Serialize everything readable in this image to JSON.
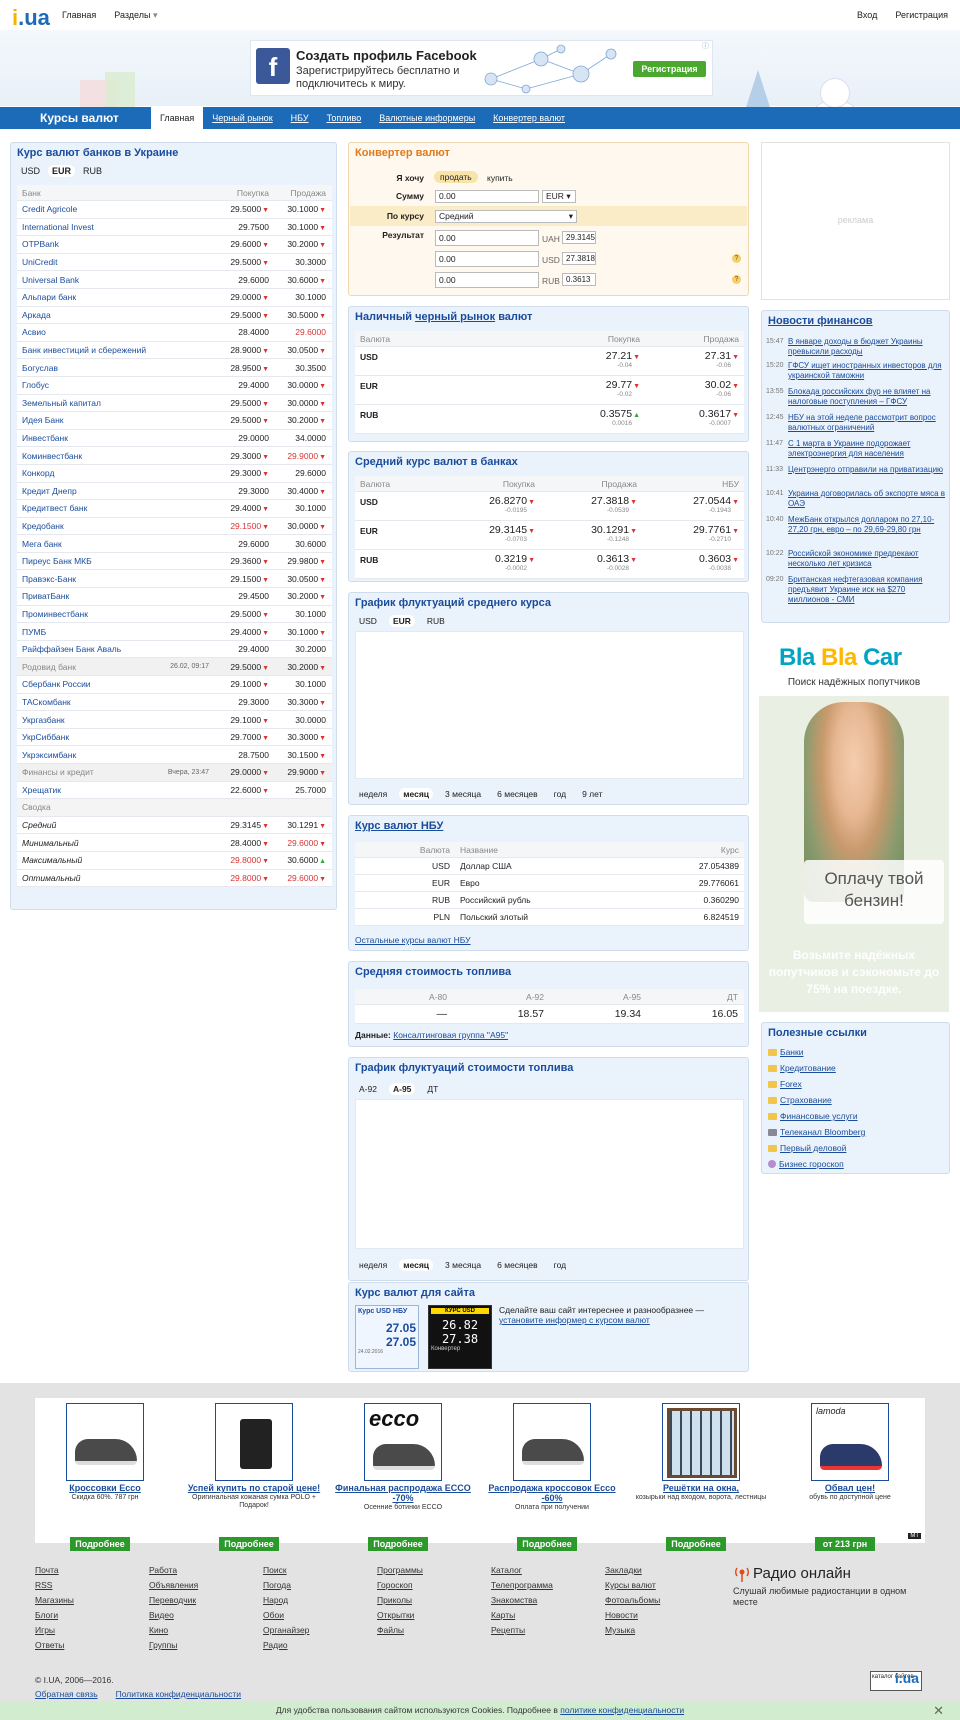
{
  "topbar": {
    "home": "Главная",
    "sections": "Разделы",
    "login": "Вход",
    "register": "Регистрация"
  },
  "fb_ad": {
    "title": "Создать профиль Facebook",
    "subtitle": "Зарегистрируйтесь бесплатно и подключитесь к миру.",
    "button": "Регистрация"
  },
  "nav": {
    "title": "Курсы валют",
    "tabs": [
      "Главная",
      "Черный рынок",
      "НБУ",
      "Топливо",
      "Валютные информеры",
      "Конвертер валют"
    ]
  },
  "banks": {
    "title": "Курс валют банков в Украине",
    "currencies": [
      "USD",
      "EUR",
      "RUB"
    ],
    "headers": [
      "Банк",
      "Покупка",
      "Продажа"
    ],
    "rows": [
      {
        "name": "Credit Agricole",
        "buy": "29.5000",
        "sell": "30.1000"
      },
      {
        "name": "International Invest",
        "buy": "29.7500",
        "sell": "30.1000"
      },
      {
        "name": "OTPBank",
        "buy": "29.6000",
        "sell": "30.2000"
      },
      {
        "name": "UniCredit",
        "buy": "29.5000",
        "sell": "30.3000"
      },
      {
        "name": "Universal Bank",
        "buy": "29.6000",
        "sell": "30.6000"
      },
      {
        "name": "Альпари банк",
        "buy": "29.0000",
        "sell": "30.1000"
      },
      {
        "name": "Аркада",
        "buy": "29.5000",
        "sell": "30.5000"
      },
      {
        "name": "Асвио",
        "buy": "28.4000",
        "sell": "29.6000"
      },
      {
        "name": "Банк инвестиций и сбережений",
        "buy": "28.9000",
        "sell": "30.0500"
      },
      {
        "name": "Богуслав",
        "buy": "28.9500",
        "sell": "30.3500"
      },
      {
        "name": "Глобус",
        "buy": "29.4000",
        "sell": "30.0000"
      },
      {
        "name": "Земельный капитал",
        "buy": "29.5000",
        "sell": "30.0000"
      },
      {
        "name": "Идея Банк",
        "buy": "29.5000",
        "sell": "30.2000"
      },
      {
        "name": "Инвестбанк",
        "buy": "29.0000",
        "sell": "34.0000"
      },
      {
        "name": "Коминвестбанк",
        "buy": "29.3000",
        "sell": "29.9000"
      },
      {
        "name": "Конкорд",
        "buy": "29.3000",
        "sell": "29.6000"
      },
      {
        "name": "Кредит Днепр",
        "buy": "29.3000",
        "sell": "30.4000"
      },
      {
        "name": "Кредитвест банк",
        "buy": "29.4000",
        "sell": "30.1000"
      },
      {
        "name": "Кредобанк",
        "buy": "29.1500",
        "sell": "30.0000"
      },
      {
        "name": "Мега банк",
        "buy": "29.6000",
        "sell": "30.6000"
      },
      {
        "name": "Пиреус Банк МКБ",
        "buy": "29.3600",
        "sell": "29.9800"
      },
      {
        "name": "Правэкс-Банк",
        "buy": "29.1500",
        "sell": "30.0500"
      },
      {
        "name": "ПриватБанк",
        "buy": "29.4500",
        "sell": "30.2000"
      },
      {
        "name": "Проминвестбанк",
        "buy": "29.5000",
        "sell": "30.1000"
      },
      {
        "name": "ПУМБ",
        "buy": "29.4000",
        "sell": "30.1000"
      },
      {
        "name": "Райффайзен Банк Аваль",
        "buy": "29.4000",
        "sell": "30.2000"
      },
      {
        "name": "Родовид банк",
        "date": "26.02, 09:17",
        "buy": "29.5000",
        "sell": "30.2000"
      },
      {
        "name": "Сбербанк России",
        "buy": "29.1000",
        "sell": "30.1000"
      },
      {
        "name": "ТАСкомбанк",
        "buy": "29.3000",
        "sell": "30.3000"
      },
      {
        "name": "Укргазбанк",
        "buy": "29.1000",
        "sell": "30.0000"
      },
      {
        "name": "УкрСиббанк",
        "buy": "29.7000",
        "sell": "30.3000"
      },
      {
        "name": "Укрэксимбанк",
        "buy": "28.7500",
        "sell": "30.1500"
      },
      {
        "name": "Финансы и кредит",
        "date": "Вчера, 23:47",
        "buy": "29.0000",
        "sell": "29.9000"
      },
      {
        "name": "Хрещатик",
        "buy": "22.6000",
        "sell": "25.7000"
      }
    ],
    "summary_title": "Сводка",
    "summary": [
      {
        "name": "Средний",
        "buy": "29.3145",
        "sell": "30.1291"
      },
      {
        "name": "Минимальный",
        "buy": "28.4000",
        "sell": "29.6000"
      },
      {
        "name": "Максимальный",
        "buy": "29.8000",
        "sell": "30.6000"
      },
      {
        "name": "Оптимальный",
        "buy": "29.8000",
        "sell": "29.6000"
      }
    ]
  },
  "converter": {
    "title": "Конвертер валют",
    "want_label": "Я хочу",
    "sell": "продать",
    "buy": "купить",
    "amount_label": "Сумму",
    "amount": "0.00",
    "currency": "EUR",
    "rate_label": "По курсу",
    "rate": "Средний",
    "result_label": "Результат",
    "results": [
      {
        "value": "0.00",
        "cur": "UAH",
        "rate": "29.3145"
      },
      {
        "value": "0.00",
        "cur": "USD",
        "rate": "27.3818"
      },
      {
        "value": "0.00",
        "cur": "RUB",
        "rate": "0.3613"
      }
    ]
  },
  "cash": {
    "title_a": "Наличный",
    "title_b": "черный рынок",
    "title_c": "валют",
    "headers": [
      "Валюта",
      "Покупка",
      "Продажа"
    ],
    "rows": [
      {
        "cur": "USD",
        "buy": "27.21",
        "buy_d": "-0.04",
        "sell": "27.31",
        "sell_d": "-0.06"
      },
      {
        "cur": "EUR",
        "buy": "29.77",
        "buy_d": "-0.02",
        "sell": "30.02",
        "sell_d": "-0.06"
      },
      {
        "cur": "RUB",
        "buy": "0.3575",
        "buy_d": "0.0016",
        "sell": "0.3617",
        "sell_d": "-0.0007"
      }
    ]
  },
  "avg": {
    "title": "Средний курс валют в банках",
    "headers": [
      "Валюта",
      "Покупка",
      "Продажа",
      "НБУ"
    ],
    "rows": [
      {
        "cur": "USD",
        "buy": "26.8270",
        "buy_d": "-0.0195",
        "sell": "27.3818",
        "sell_d": "-0.0539",
        "nbu": "27.0544",
        "nbu_d": "-0.1943"
      },
      {
        "cur": "EUR",
        "buy": "29.3145",
        "buy_d": "-0.0703",
        "sell": "30.1291",
        "sell_d": "-0.1248",
        "nbu": "29.7761",
        "nbu_d": "-0.2710"
      },
      {
        "cur": "RUB",
        "buy": "0.3219",
        "buy_d": "-0.0002",
        "sell": "0.3613",
        "sell_d": "-0.0028",
        "nbu": "0.3603",
        "nbu_d": "-0.0038"
      }
    ]
  },
  "chart1": {
    "title": "График флуктуаций среднего курса",
    "tabs": [
      "USD",
      "EUR",
      "RUB"
    ],
    "periods": [
      "неделя",
      "месяц",
      "3 месяца",
      "6 месяцев",
      "год",
      "9 лет"
    ]
  },
  "nbu": {
    "title": "Курс валют НБУ",
    "headers": [
      "Валюта",
      "Название",
      "Курс"
    ],
    "rows": [
      {
        "code": "USD",
        "name": "Доллар США",
        "rate": "27.054389"
      },
      {
        "code": "EUR",
        "name": "Евро",
        "rate": "29.776061"
      },
      {
        "code": "RUB",
        "name": "Российский рубль",
        "rate": "0.360290"
      },
      {
        "code": "PLN",
        "name": "Польский злотый",
        "rate": "6.824519"
      }
    ],
    "more": "Остальные курсы валют НБУ"
  },
  "fuel": {
    "title": "Средняя стоимость топлива",
    "headers": [
      "А-80",
      "А-92",
      "А-95",
      "ДТ"
    ],
    "values": [
      "—",
      "18.57",
      "19.34",
      "16.05"
    ],
    "source_label": "Данные:",
    "source": "Консалтинговая группа \"А95\""
  },
  "chart2": {
    "title": "График флуктуаций стоимости топлива",
    "tabs": [
      "А-92",
      "А-95",
      "ДТ"
    ],
    "periods": [
      "неделя",
      "месяц",
      "3 месяца",
      "6 месяцев",
      "год"
    ]
  },
  "informer": {
    "title": "Курс валют для сайта",
    "text": "Сделайте ваш сайт интереснее и разнообразнее —",
    "link": "установите информер с курсом валют",
    "w1": {
      "h": "Курс USD НБУ",
      "v1": "27.05",
      "v2": "27.05",
      "d": "24.02.2016"
    },
    "w2": {
      "h": "КУРС USD",
      "v1": "26.82",
      "v2": "27.38",
      "foot": "Конвертер"
    }
  },
  "right_ad": "реклама",
  "news": {
    "title": "Новости финансов",
    "items": [
      {
        "t": "15:47",
        "x": "В январе доходы в бюджет Украины превысили расходы"
      },
      {
        "t": "15:20",
        "x": "ГФСУ ищет иностранных инвесторов для украинской таможни"
      },
      {
        "t": "13:55",
        "x": "Блокада российских фур не влияет на налоговые поступления – ГФСУ"
      },
      {
        "t": "12:45",
        "x": "НБУ на этой неделе рассмотрит вопрос валютных ограничений"
      },
      {
        "t": "11:47",
        "x": "С 1 марта в Украине подорожает электроэнергия для населения"
      },
      {
        "t": "11:33",
        "x": "Центрэнерго отправили на приватизацию"
      },
      {
        "t": "10:41",
        "x": "Украина договорилась об экспорте мяса в ОАЭ"
      },
      {
        "t": "10:40",
        "x": "МежБанк открылся долларом по 27,10-27,20 грн, евро – по 29,69-29,80 грн"
      },
      {
        "t": "10:22",
        "x": "Российской экономике предрекают несколько лет кризиса"
      },
      {
        "t": "09:20",
        "x": "Британская нефтегазовая компания предъявит Украине иск на $270 миллионов - СМИ"
      }
    ]
  },
  "blablacar": {
    "logo_a": "Bla",
    "logo_b": "Bla",
    "logo_c": "Car",
    "sub": "Поиск надёжных попутчиков",
    "bubble": "Оплачу твой бензин!",
    "bottom": "Возьмите надёжных попутчиков и сэкономьте до 75% на поездке."
  },
  "links": {
    "title": "Полезные ссылки",
    "items": [
      "Банки",
      "Кредитование",
      "Forex",
      "Страхование",
      "Финансовые услуги",
      "Телеканал Bloomberg",
      "Первый деловой",
      "Бизнес гороскоп"
    ]
  },
  "products": [
    {
      "title": "Кроссовки Ecco",
      "desc": "Скидка 60%. 787 грн",
      "btn": "Подробнее"
    },
    {
      "title": "Успей купить по старой цене!",
      "desc": "Оригинальная кожаная сумка POLO + Подарок!",
      "btn": "Подробнее"
    },
    {
      "title": "Финальная распродажа ECCO -70%",
      "desc": "Осенние ботинки ECCO",
      "btn": "Подробнее",
      "logo": "ecco"
    },
    {
      "title": "Распродажа кроссовок Ecco -60%",
      "desc": "Оплата при получении",
      "btn": "Подробнее"
    },
    {
      "title": "Решётки на окна,",
      "desc": "козырьки над входом, ворота, лестницы",
      "btn": "Подробнее"
    },
    {
      "title": "Обвал цен!",
      "desc": "обувь по доступной цене",
      "btn": "от 213 грн",
      "logo": "lamoda"
    }
  ],
  "footer": {
    "cols": [
      [
        "Почта",
        "RSS",
        "Магазины",
        "Блоги",
        "Игры",
        "Ответы"
      ],
      [
        "Работа",
        "Объявления",
        "Переводчик",
        "Видео",
        "Кино",
        "Группы"
      ],
      [
        "Поиск",
        "Погода",
        "Народ",
        "Обои",
        "Органайзер",
        "Радио"
      ],
      [
        "Программы",
        "Гороскоп",
        "Приколы",
        "Открытки",
        "Файлы"
      ],
      [
        "Каталог",
        "Телепрограмма",
        "Знакомства",
        "Карты",
        "Рецепты"
      ],
      [
        "Закладки",
        "Курсы валют",
        "Фотоальбомы",
        "Новости",
        "Музыка"
      ]
    ],
    "radio_title": "Радио онлайн",
    "radio_desc": "Слушай любимые радиостанции в одном месте",
    "copyright": "© I.UA, 2006—2016.",
    "feedback": "Обратная связь",
    "privacy": "Политика конфиденциальности",
    "badge": "каталог сайтов"
  },
  "cookie": {
    "text": "Для удобства пользования сайтом используются Cookies. Подробнее в",
    "link": "политике конфиденциальности"
  }
}
